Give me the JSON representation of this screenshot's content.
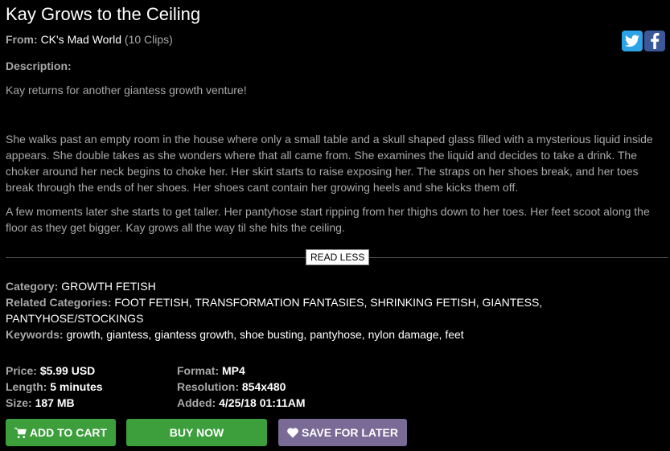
{
  "title": "Kay Grows to the Ceiling",
  "from": {
    "label": "From:",
    "studio": "CK's Mad World",
    "clips": "(10 Clips)"
  },
  "social": {
    "twitter_icon": "twitter-icon",
    "facebook_icon": "facebook-icon"
  },
  "description": {
    "label": "Description:",
    "paragraphs": [
      "Kay returns for another giantess growth venture!",
      "She walks past an empty room in the house where only a small table and a skull shaped glass filled with a mysterious liquid inside appears.  She double takes as she wonders where that all came from.  She examines the liquid and decides to take a drink.  The choker around her neck begins to choke her.  Her skirt starts to raise exposing her.  The straps on her shoes break, and her toes break through the ends of her shoes. Her shoes cant contain her growing heels and she kicks them off.",
      "A few moments later she starts to get taller.  Her pantyhose start ripping from her thighs down to her toes.  Her feet scoot along the floor as they get bigger. Kay grows all the way til she hits the ceiling."
    ],
    "toggle": "READ LESS"
  },
  "category": {
    "label": "Category:",
    "value": "GROWTH FETISH"
  },
  "related": {
    "label": "Related Categories:",
    "value": "FOOT FETISH, TRANSFORMATION FANTASIES, SHRINKING FETISH, GIANTESS, PANTYHOSE/STOCKINGS"
  },
  "keywords": {
    "label": "Keywords:",
    "value": "growth, giantess, giantess growth, shoe busting, pantyhose, nylon damage, feet"
  },
  "details": {
    "price_label": "Price:",
    "price": "$5.99 USD",
    "length_label": "Length:",
    "length": "5 minutes",
    "size_label": "Size:",
    "size": "187 MB",
    "format_label": "Format:",
    "format": "MP4",
    "resolution_label": "Resolution:",
    "resolution": "854x480",
    "added_label": "Added:",
    "added": "4/25/18 01:11AM"
  },
  "buttons": {
    "add_to_cart": "ADD TO CART",
    "buy_now": "BUY NOW",
    "save_for_later": "SAVE FOR LATER"
  },
  "colors": {
    "green": "#3c9f3c",
    "purple": "#7a6a96",
    "twitter": "#2ba3e6",
    "facebook": "#3b5998"
  }
}
